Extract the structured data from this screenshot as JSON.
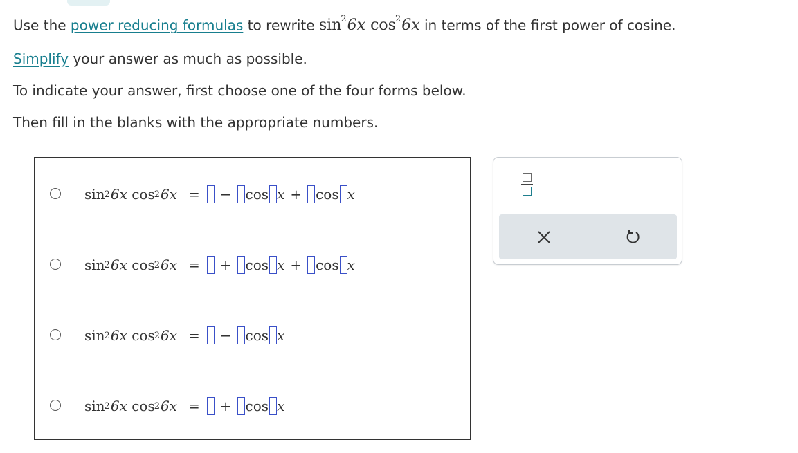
{
  "intro": {
    "use_the": "Use the",
    "link_power_reducing": "power reducing formulas",
    "to_rewrite": "to rewrite",
    "in_terms_of": "in terms of the first power of cosine."
  },
  "simplify": {
    "link": "Simplify",
    "rest": "your answer as much as possible."
  },
  "indicate_text": "To indicate your answer, first choose one of the four forms below.",
  "fill_text": "Then fill in the blanks with the appropriate numbers.",
  "math": {
    "sin": "sin",
    "cos": "cos",
    "exp": "2",
    "arg": "6x",
    "x": "x",
    "equals": "=",
    "minus": "−",
    "plus": "+"
  },
  "options": [
    {
      "form": "a - b cos(cx) + d cos(ex)"
    },
    {
      "form": "a + b cos(cx) + d cos(ex)"
    },
    {
      "form": "a - b cos(cx)"
    },
    {
      "form": "a + b cos(cx)"
    }
  ],
  "tools": {
    "fraction_icon": "fraction-icon",
    "clear_icon": "close-icon",
    "undo_icon": "undo-icon"
  },
  "colors": {
    "link": "#177e8e",
    "blank_border": "#3a50c8",
    "toolbar_bg": "#dfe4e8"
  }
}
